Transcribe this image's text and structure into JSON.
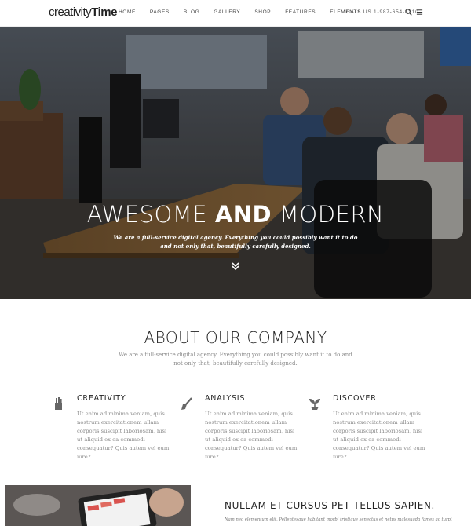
{
  "brand": {
    "part1": "creativity",
    "part2": "Time"
  },
  "menu": [
    {
      "label": "HOME",
      "active": true
    },
    {
      "label": "PAGES",
      "active": false
    },
    {
      "label": "BLOG",
      "active": false
    },
    {
      "label": "GALLERY",
      "active": false
    },
    {
      "label": "SHOP",
      "active": false
    },
    {
      "label": "FEATURES",
      "active": false
    },
    {
      "label": "ELEMENTS",
      "active": false
    }
  ],
  "call": "CALL US 1-987-654-3210",
  "icons": {
    "search": "search-icon",
    "menu": "hamburger-menu-icon",
    "scroll_down": "double-chevron-down-icon"
  },
  "hero": {
    "title_light_1": "AWESOME ",
    "title_bold": "AND",
    "title_light_2": " MODERN",
    "subtitle": "We are a full-service digital agency. Everything you could possibly want it to do and not only that, beautifully carefully designed."
  },
  "about": {
    "title": "ABOUT OUR COMPANY",
    "text": "We are a full-service digital agency. Everything you could possibly want it to do and not only that, beautifully carefully designed."
  },
  "features": [
    {
      "icon": "pencil-cup-icon",
      "title": "CREATIVITY",
      "text": "Ut enim ad minima veniam, quis nostrum exercitationem ullam corporis suscipit laboriosam, nisi ut aliquid ex ea commodi consequatur? Quis autem vel eum iure?"
    },
    {
      "icon": "paint-brush-icon",
      "title": "ANALYSIS",
      "text": "Ut enim ad minima veniam, quis nostrum exercitationem ullam corporis suscipit laboriosam, nisi ut aliquid ex ea commodi consequatur? Quis autem vel eum iure?"
    },
    {
      "icon": "sprout-icon",
      "title": "DISCOVER",
      "text": "Ut enim ad minima veniam, quis nostrum exercitationem ullam corporis suscipit laboriosam, nisi ut aliquid ex ea commodi consequatur? Quis autem vel eum iure?"
    }
  ],
  "bottom": {
    "title": "NULLAM ET CURSUS PET TELLUS SAPIEN.",
    "text": "Nam nec elementum elit. Pellentesque habitant morbi tristique senectus et netus malesuada fames ac turpis"
  },
  "colors": {
    "text_dark": "#222222",
    "text_muted": "#8a8a8a",
    "hero_overlay": "#2e2a27"
  }
}
